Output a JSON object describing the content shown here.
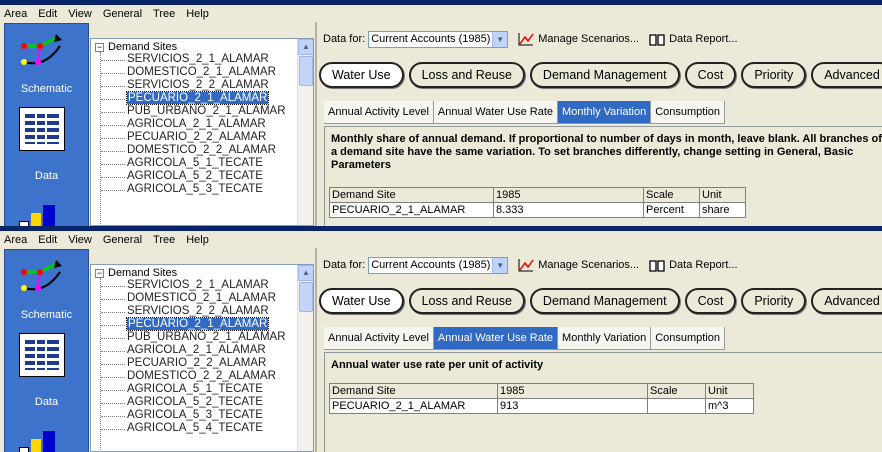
{
  "menu": [
    "Area",
    "Edit",
    "View",
    "General",
    "Tree",
    "Help"
  ],
  "sidebar": {
    "schematic": "Schematic",
    "data": "Data"
  },
  "tree": {
    "root": "Demand Sites",
    "top_items": [
      "SERVICIOS_2_1_ALAMAR",
      "DOMESTICO_2_1_ALAMAR",
      "SERVICIOS_2_2_ALAMAR",
      "PECUARIO_2_1_ALAMAR",
      "PUB_URBANO_2_1_ALAMAR",
      "AGRICOLA_2_1_ALAMAR",
      "PECUARIO_2_2_ALAMAR",
      "DOMESTICO_2_2_ALAMAR",
      "AGRICOLA_5_1_TECATE",
      "AGRICOLA_5_2_TECATE",
      "AGRICOLA_5_3_TECATE"
    ],
    "bottom_items": [
      "SERVICIOS_2_1_ALAMAR",
      "DOMESTICO_2_1_ALAMAR",
      "SERVICIOS_2_2_ALAMAR",
      "PECUARIO_2_1_ALAMAR",
      "PUB_URBANO_2_1_ALAMAR",
      "AGRICOLA_2_1_ALAMAR",
      "PECUARIO_2_2_ALAMAR",
      "DOMESTICO_2_2_ALAMAR",
      "AGRICOLA_5_1_TECATE",
      "AGRICOLA_5_2_TECATE",
      "AGRICOLA_5_3_TECATE",
      "AGRICOLA_5_4_TECATE"
    ],
    "selected": "PECUARIO_2_1_ALAMAR"
  },
  "toolbar": {
    "data_for": "Data for:",
    "scenario": "Current Accounts (1985)",
    "manage": "Manage Scenarios...",
    "report": "Data Report..."
  },
  "main_tabs": [
    "Water Use",
    "Loss and Reuse",
    "Demand Management",
    "Cost",
    "Priority",
    "Advanced"
  ],
  "sub_tabs": [
    "Annual Activity Level",
    "Annual Water Use Rate",
    "Monthly Variation",
    "Consumption"
  ],
  "top_view": {
    "active_subtab": "Monthly Variation",
    "description": "Monthly share of annual demand. If proportional to number of days in month, leave blank. All branches of a demand site have the same variation. To set branches differently, change setting in General, Basic Parameters",
    "headers": [
      "Demand Site",
      "1985",
      "Scale",
      "Unit"
    ],
    "row": [
      "PECUARIO_2_1_ALAMAR",
      "8.333",
      "Percent",
      "share"
    ]
  },
  "bottom_view": {
    "active_subtab": "Annual Water Use Rate",
    "description": "Annual water use rate per unit of activity",
    "headers": [
      "Demand Site",
      "1985",
      "Scale",
      "Unit"
    ],
    "row": [
      "PECUARIO_2_1_ALAMAR",
      "913",
      "",
      "m^3"
    ]
  },
  "colors": {
    "accent": "#316ac5",
    "sidebar": "#3e73cc",
    "titlebar": "#0a246a"
  }
}
